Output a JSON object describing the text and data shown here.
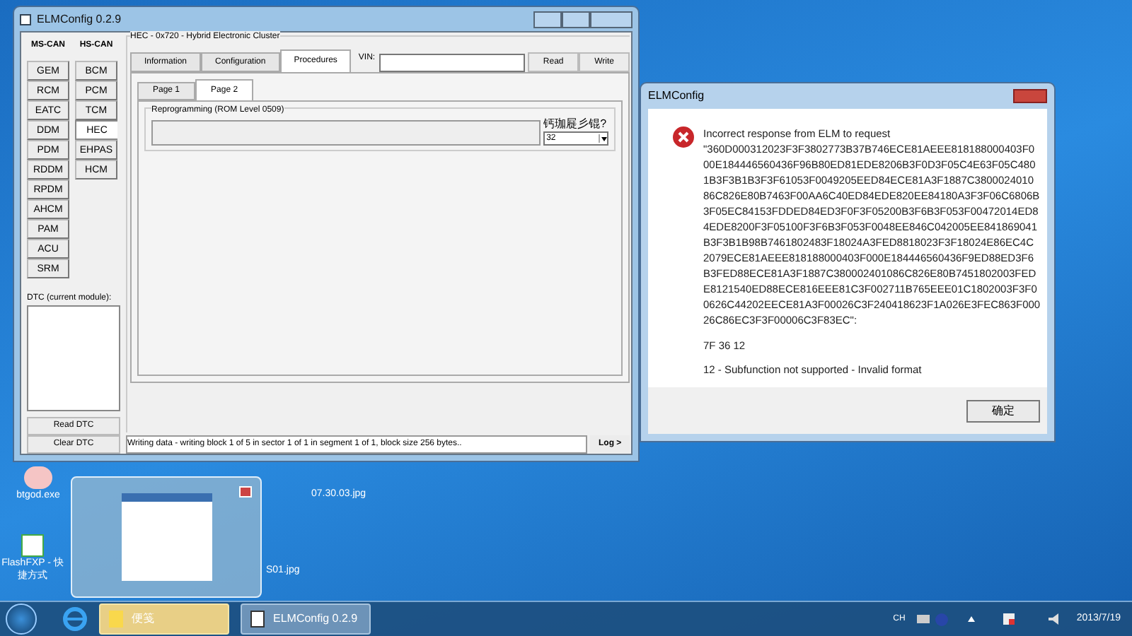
{
  "main_window": {
    "title": "ELMConfig 0.2.9",
    "ms_can_label": "MS-CAN",
    "hs_can_label": "HS-CAN",
    "ms_can_modules": [
      {
        "label": "GEM",
        "selected": false
      },
      {
        "label": "RCM",
        "selected": false
      },
      {
        "label": "EATC",
        "selected": false
      },
      {
        "label": "DDM",
        "selected": false
      },
      {
        "label": "PDM",
        "selected": false
      },
      {
        "label": "RDDM",
        "selected": false
      },
      {
        "label": "RPDM",
        "selected": false
      },
      {
        "label": "AHCM",
        "selected": false
      },
      {
        "label": "PAM",
        "selected": false
      },
      {
        "label": "ACU",
        "selected": false
      },
      {
        "label": "SRM",
        "selected": false
      }
    ],
    "hs_can_modules": [
      {
        "label": "BCM",
        "selected": false
      },
      {
        "label": "PCM",
        "selected": false
      },
      {
        "label": "TCM",
        "selected": false
      },
      {
        "label": "HEC",
        "selected": true
      },
      {
        "label": "EHPAS",
        "selected": false
      },
      {
        "label": "HCM",
        "selected": false
      }
    ],
    "module_title": "HEC - 0x720 - Hybrid Electronic Cluster",
    "tabs": [
      {
        "label": "Information",
        "selected": false
      },
      {
        "label": "Configuration",
        "selected": false
      },
      {
        "label": "Procedures",
        "selected": true
      }
    ],
    "vin_label": "VIN:",
    "read_button": "Read",
    "write_button": "Write",
    "pages": [
      {
        "label": "Page 1",
        "selected": false
      },
      {
        "label": "Page 2",
        "selected": true
      }
    ],
    "group_title": "Reprogramming (ROM Level 0509)",
    "option_label": "钙珈屣彡锟?",
    "option_value": "32",
    "dtc_label": "DTC (current module):",
    "read_dtc_button": "Read DTC",
    "clear_dtc_button": "Clear DTC",
    "status": "Writing data - writing block 1 of 5 in sector 1 of 1 in segment 1 of 1, block size 256 bytes..",
    "log_button": "Log >"
  },
  "dialog": {
    "title": "ELMConfig",
    "message_lines": [
      "Incorrect response from ELM to request",
      "\"360D000312023F3F3802773B37B746ECE81AEEE818188000403F0",
      "00E184446560436F96B80ED81EDE8206B3F0D3F05C4E63F05C480",
      "1B3F3B1B3F3F61053F0049205EED84ECE81A3F1887C3800024010",
      "86C826E80B7463F00AA6C40ED84EDE820EE84180A3F3F06C6806B",
      "3F05EC84153FDDED84ED3F0F3F05200B3F6B3F053F00472014ED8",
      "4EDE8200F3F05100F3F6B3F053F0048EE846C042005EE841869041",
      "B3F3B1B98B7461802483F18024A3FED8818023F3F18024E86EC4C",
      "2079ECE81AEEE818188000403F000E184446560436F9ED88ED3F6",
      "B3FED88ECE81A3F1887C380002401086C826E80B7451802003FED",
      "E8121540ED88ECE816EEE81C3F002711B765EEE01C1802003F3F0",
      "0626C44202EECE81A3F00026C3F240418623F1A026E3FEC863F000",
      "26C86EC3F3F00006C3F83EC\":"
    ],
    "response": "7F 36 12",
    "error": "12 - Subfunction not supported - Invalid format",
    "ok_button": "确定"
  },
  "desktop_icons": [
    {
      "label": "btgod.exe"
    },
    {
      "label": "FlashFXP - 快捷方式"
    },
    {
      "label": "07.30.03.jpg"
    },
    {
      "label": "S01.jpg"
    }
  ],
  "taskbar": {
    "items": [
      {
        "label": "便笺",
        "selected": true
      },
      {
        "label": "ELMConfig 0.2.9",
        "selected": false
      }
    ],
    "language": "CH",
    "date": "2013/7/19"
  }
}
